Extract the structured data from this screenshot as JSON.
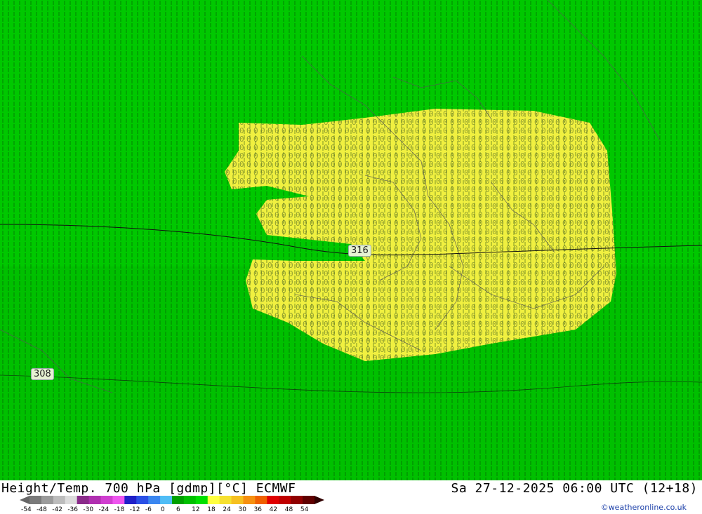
{
  "title_left": "Height/Temp. 700 hPa [gdmp][°C] ECMWF",
  "title_right": "Sa 27-12-2025 06:00 UTC (12+18)",
  "credit": "©weatheronline.co.uk",
  "scale_labels": [
    "-54",
    "-48",
    "-42",
    "-36",
    "-30",
    "-24",
    "-18",
    "-12",
    "-6",
    "0",
    "6",
    "12",
    "18",
    "24",
    "30",
    "36",
    "42",
    "48",
    "54"
  ],
  "scale_colors": [
    "#7a7a7a",
    "#9b9b9b",
    "#bcbcbc",
    "#dcdcdc",
    "#8a2b8a",
    "#b02fb0",
    "#d03ed0",
    "#ee55ee",
    "#2020c8",
    "#2a50e6",
    "#3a86f0",
    "#4fbdf6",
    "#00a000",
    "#00c000",
    "#00e000",
    "#ffff40",
    "#f6e030",
    "#f6c020",
    "#f69010",
    "#f06000",
    "#e00000",
    "#c00000",
    "#900000",
    "#600000"
  ],
  "contour_labels": [
    "316",
    "308"
  ],
  "colors": {
    "map_green": "#00c800",
    "warm_yellow": "#f0f040",
    "land_border": "#555555"
  }
}
